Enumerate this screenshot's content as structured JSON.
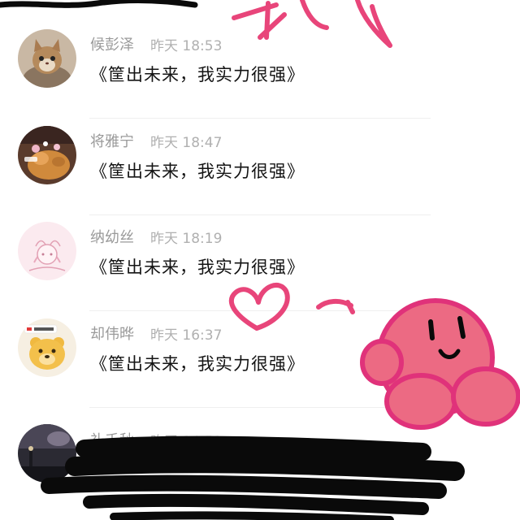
{
  "comments": [
    {
      "username": "候彭泽",
      "time": "昨天 18:53",
      "text": "《筐出未来，我实力很强》",
      "avatar_icon": "cat-avatar-icon"
    },
    {
      "username": "将雅宁",
      "time": "昨天 18:47",
      "text": "《筐出未来，我实力很强》",
      "avatar_icon": "dog-avatar-icon"
    },
    {
      "username": "纳幼丝",
      "time": "昨天 18:19",
      "text": "《筐出未来，我实力很强》",
      "avatar_icon": "anime-sketch-avatar-icon"
    },
    {
      "username": "却伟晔",
      "time": "昨天 16:37",
      "text": "《筐出未来，我实力很强》",
      "avatar_icon": "cartoon-bear-avatar-icon"
    },
    {
      "username": "礼千秋",
      "time": "昨天 14:52",
      "text": "",
      "avatar_icon": "night-scene-avatar-icon"
    }
  ],
  "colors": {
    "doodle_pink": "#e8457a",
    "kirby_fill": "#ec6a83",
    "kirby_outline": "#e0327a",
    "scribble_black": "#0a0a0a",
    "text_primary": "#141414",
    "text_secondary": "#9a9a9a"
  }
}
